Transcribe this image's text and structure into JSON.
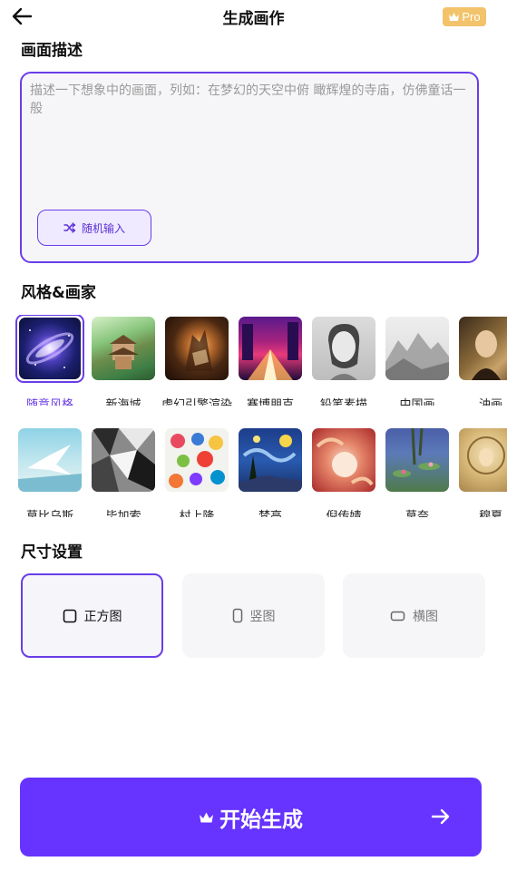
{
  "header": {
    "title": "生成画作",
    "pro_label": "Pro",
    "back_icon": "arrow-left-icon",
    "crown_icon": "crown-icon"
  },
  "description": {
    "section_title": "画面描述",
    "value": "",
    "placeholder": "描述一下想象中的画面，列如：在梦幻的天空中俯 瞰辉煌的寺庙，仿佛童话一般",
    "random_button_label": "随机输入",
    "random_icon": "shuffle-icon"
  },
  "styles": {
    "section_title": "风格&画家",
    "selected": "随意风格",
    "row1": [
      "随意风格",
      "新海城",
      "虚幻引擎渲染",
      "赛博朋克",
      "铅笔素描",
      "中国画",
      "油画"
    ],
    "row2": [
      "莫比乌斯",
      "毕加索",
      "村上隆",
      "梵高",
      "倪传婧",
      "莫奈",
      "穆夏"
    ]
  },
  "size": {
    "section_title": "尺寸设置",
    "options": [
      "正方图",
      "竖图",
      "横图"
    ],
    "selected": "正方图"
  },
  "generate": {
    "label": "开始生成",
    "icon": "crown-icon",
    "arrow_icon": "arrow-right-icon"
  },
  "colors": {
    "accent": "#6a3de8",
    "button": "#6633ff",
    "pro_badge": "#f2c36b"
  }
}
